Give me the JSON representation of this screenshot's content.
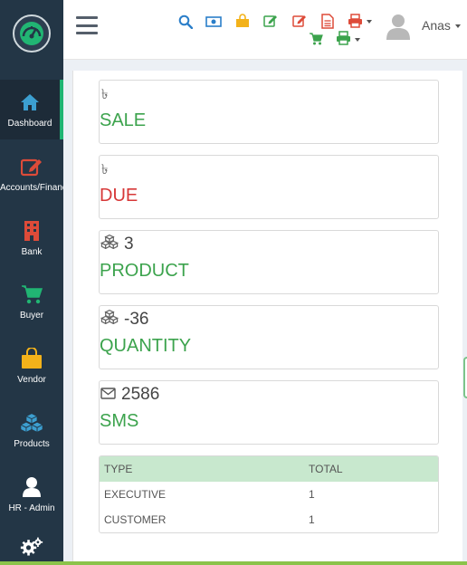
{
  "header": {
    "user_name": "Anas",
    "icons": [
      "search-icon",
      "money-icon",
      "shopping-bag-icon",
      "edit-icon",
      "edit-red-icon",
      "file-icon",
      "print-dropdown-icon",
      "cart-icon",
      "print-green-dropdown-icon"
    ]
  },
  "sidebar": {
    "items": [
      {
        "label": "Dashboard",
        "icon": "home-icon",
        "color": "#3c8dbc"
      },
      {
        "label": "Accounts/Finance",
        "icon": "edit-icon",
        "color": "#dd4b39"
      },
      {
        "label": "Bank",
        "icon": "building-icon",
        "color": "#dd4b39"
      },
      {
        "label": "Buyer",
        "icon": "cart-icon",
        "color": "#00a65a"
      },
      {
        "label": "Vendor",
        "icon": "shopping-bag-icon",
        "color": "#f39c12"
      },
      {
        "label": "Products",
        "icon": "cubes-icon",
        "color": "#3c8dbc"
      },
      {
        "label": "HR - Admin",
        "icon": "user-icon",
        "color": "#ffffff"
      }
    ]
  },
  "cards": [
    {
      "value": "৳",
      "label": "SALE",
      "color": "#3ca34d",
      "icon": "taka-icon"
    },
    {
      "value": "৳",
      "label": "DUE",
      "color": "#d73838",
      "icon": "taka-icon"
    },
    {
      "value": "3",
      "label": "PRODUCT",
      "color": "#3ca34d",
      "icon": "cubes-icon"
    },
    {
      "value": "-36",
      "label": "QUANTITY",
      "color": "#3ca34d",
      "icon": "cubes-icon"
    },
    {
      "value": "2586",
      "label": "SMS",
      "color": "#3ca34d",
      "icon": "envelope-icon"
    }
  ],
  "table": {
    "headers": [
      "TYPE",
      "TOTAL"
    ],
    "rows": [
      [
        "EXECUTIVE",
        "1"
      ],
      [
        "CUSTOMER",
        "1"
      ]
    ]
  }
}
